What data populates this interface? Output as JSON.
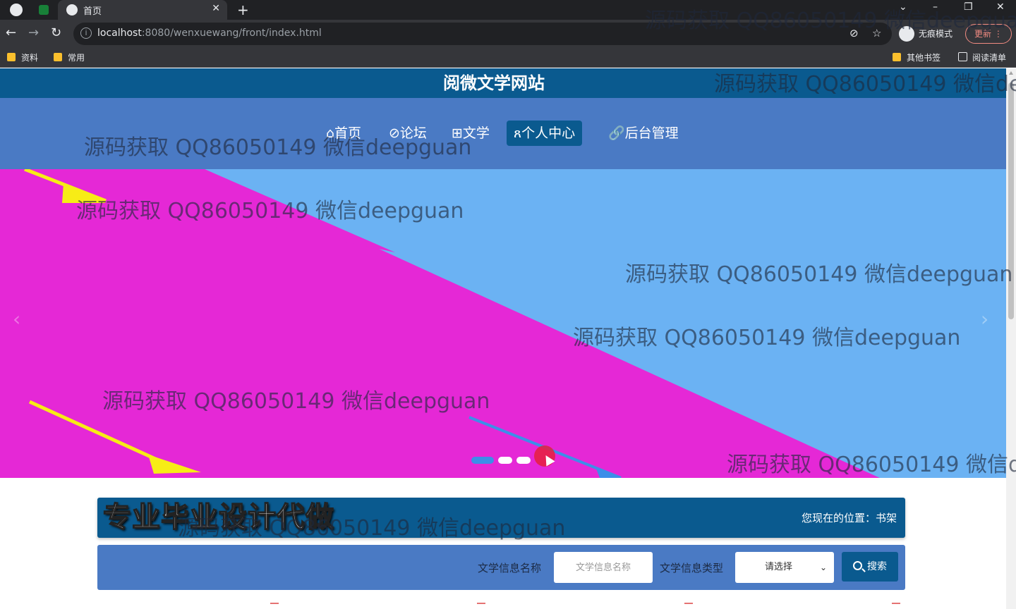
{
  "browser": {
    "tab_title": "首页",
    "tab_close": "✕",
    "new_tab": "+",
    "url_host": "localhost",
    "url_path": ":8080/wenxuewang/front/index.html",
    "incognito_label": "无痕模式",
    "update_label": "更新 ⋮",
    "bookmarks": [
      "资料",
      "常用"
    ],
    "bookmarks_right": [
      "其他书签",
      "阅读清单"
    ],
    "window_controls": [
      "⌄",
      "–",
      "❐",
      "✕"
    ]
  },
  "site": {
    "title": "阅微文学网站",
    "nav": [
      {
        "label": "⌂首页"
      },
      {
        "label": "⊘论坛"
      },
      {
        "label": "⊞文学"
      },
      {
        "label": "ጸ个人中心",
        "active": true
      },
      {
        "label": "🔗后台管理"
      }
    ]
  },
  "carousel": {
    "prev": "‹",
    "next": "›",
    "active_index": 0,
    "total": 3
  },
  "breadcrumb": {
    "promo": "专业毕业设计代做",
    "location": "您现在的位置：书架"
  },
  "search": {
    "name_label": "文学信息名称",
    "name_placeholder": "文学信息名称",
    "type_label": "文学信息类型",
    "type_selected": "请选择",
    "button_label": "搜索"
  },
  "watermark_text": "源码获取 QQ86050149 微信deepguan",
  "colors": {
    "header": "#0a5a8f",
    "navbar": "#4a7ac4",
    "banner_magenta": "#e528d6",
    "banner_blue": "#6bb2f3",
    "accent_yellow": "#f7ec16"
  }
}
